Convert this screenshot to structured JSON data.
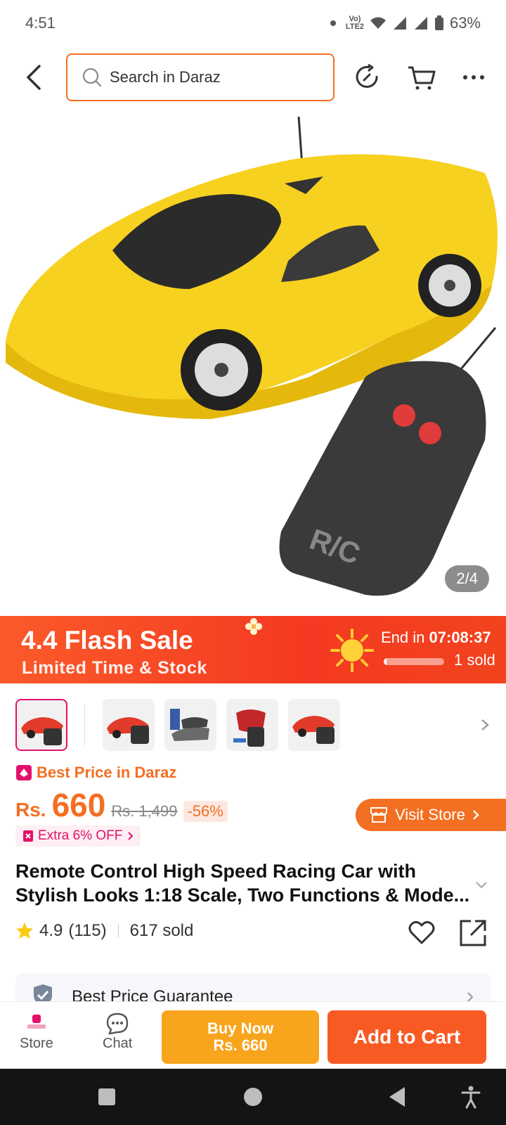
{
  "status": {
    "time": "4:51",
    "battery": "63%",
    "network": "VoLTE LTE2"
  },
  "header": {
    "search_placeholder": "Search in Daraz"
  },
  "hero": {
    "counter": "2/4"
  },
  "flash": {
    "title": "4.4 Flash Sale",
    "subtitle": "Limited Time & Stock",
    "end_label": "End in",
    "end_time": "07:08:37",
    "sold": "1 sold",
    "sold_progress": 0.05
  },
  "badges": {
    "best_price": "Best Price in Daraz",
    "extra": "Extra 6% OFF",
    "visit_store": "Visit Store"
  },
  "price": {
    "currency": "Rs.",
    "amount": "660",
    "original": "Rs. 1,499",
    "discount": "-56%"
  },
  "product": {
    "title": "Remote Control High Speed Racing Car with Stylish Looks 1:18 Scale, Two Functions & Mode...",
    "rating": "4.9",
    "reviews": "(115)",
    "sold": "617 sold"
  },
  "guarantee": {
    "label": "Best Price Guarantee"
  },
  "actions": {
    "store": "Store",
    "chat": "Chat",
    "buy_now": "Buy Now",
    "buy_price": "Rs. 660",
    "add_to_cart": "Add to Cart"
  },
  "colors": {
    "accent": "#f36f21",
    "pink": "#e3106b",
    "buy": "#f8a41c",
    "cart": "#f85a24"
  }
}
